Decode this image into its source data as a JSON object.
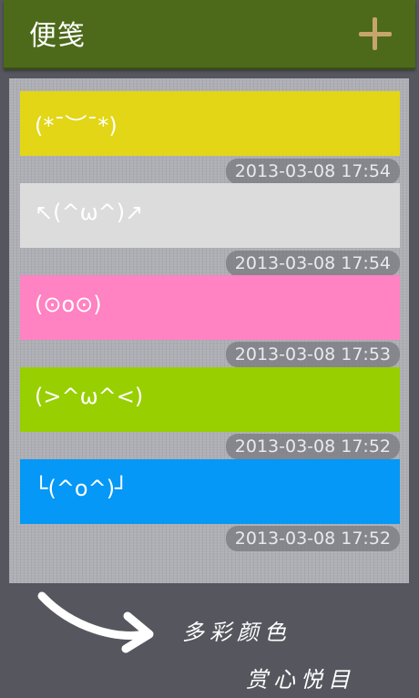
{
  "header": {
    "title": "便笺",
    "add_icon": "plus-icon"
  },
  "notes": [
    {
      "text": "(*¯︶¯*)",
      "timestamp": "2013-03-08 17:54",
      "color": "#e2d617",
      "text_color": "#ffffff"
    },
    {
      "text": "↖(^ω^)↗",
      "timestamp": "2013-03-08 17:54",
      "color": "#dcdcdc",
      "text_color": "#ffffff"
    },
    {
      "text": "(⊙o⊙)",
      "timestamp": "2013-03-08 17:53",
      "color": "#ff82c2",
      "text_color": "#ffffff"
    },
    {
      "text": "(>^ω^<)",
      "timestamp": "2013-03-08 17:52",
      "color": "#98cf00",
      "text_color": "#ffffff"
    },
    {
      "text": "└(^o^)┘",
      "timestamp": "2013-03-08 17:52",
      "color": "#0598f6",
      "text_color": "#ffffff"
    }
  ],
  "promo": {
    "line1": "多彩颜色",
    "line2": "赏心悦目",
    "arrow_icon": "curved-arrow-icon"
  }
}
